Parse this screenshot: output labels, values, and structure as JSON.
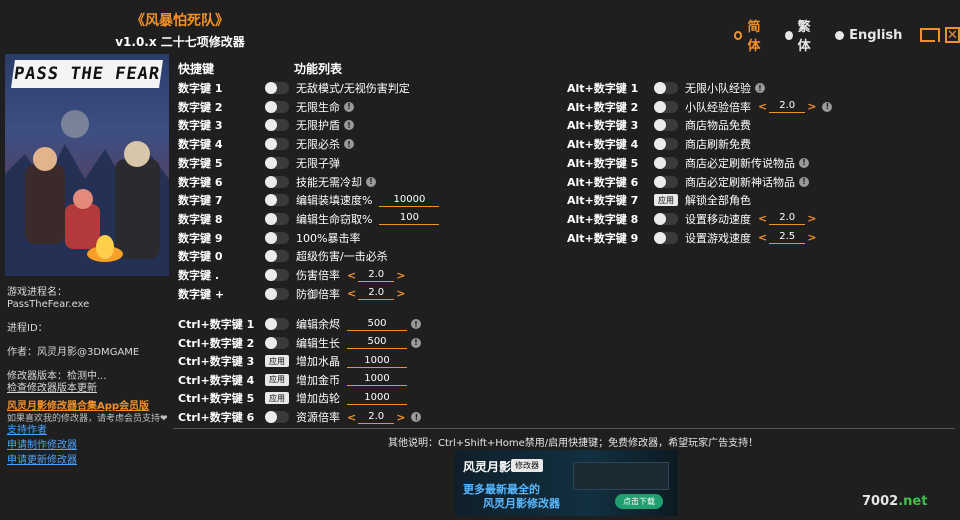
{
  "app": {
    "title": "《风暴怕死队》",
    "subtitle": "v1.0.x 二十七项修改器"
  },
  "languages": [
    {
      "label": "简体",
      "selected": true
    },
    {
      "label": "繁体",
      "selected": false
    },
    {
      "label": "English",
      "selected": false
    }
  ],
  "cover": {
    "logo_text": "PASS THE FEAR"
  },
  "side": {
    "process_label": "游戏进程名：",
    "process_value": "PassTheFear.exe",
    "pid_label": "进程ID：",
    "author": "作者：风灵月影@3DMGAME",
    "version": "修改器版本：检测中...",
    "check_update": "检查修改器版本更新",
    "promo": "风灵月影修改器合集App会员版",
    "support_msg": "如果喜欢我的修改器，请考虑会员支持❤",
    "links": [
      "支持作者",
      "申请制作修改器",
      "申请更新修改器"
    ]
  },
  "headers": {
    "hotkey": "快捷键",
    "functions": "功能列表"
  },
  "left_list": [
    {
      "key": "数字键 1",
      "ctl": "toggle",
      "name": "无敌模式/无视伤害判定"
    },
    {
      "key": "数字键 2",
      "ctl": "toggle",
      "name": "无限生命",
      "info": "!"
    },
    {
      "key": "数字键 3",
      "ctl": "toggle",
      "name": "无限护盾",
      "info": "!"
    },
    {
      "key": "数字键 4",
      "ctl": "toggle",
      "name": "无限必杀",
      "info": "!"
    },
    {
      "key": "数字键 5",
      "ctl": "toggle",
      "name": "无限子弹"
    },
    {
      "key": "数字键 6",
      "ctl": "toggle",
      "name": "技能无需冷却",
      "info": "!"
    },
    {
      "key": "数字键 7",
      "ctl": "toggle",
      "name": "编辑装填速度%",
      "field": "10000"
    },
    {
      "key": "数字键 8",
      "ctl": "toggle",
      "name": "编辑生命窃取%",
      "field": "100"
    },
    {
      "key": "数字键 9",
      "ctl": "toggle",
      "name": "100%暴击率"
    },
    {
      "key": "数字键 0",
      "ctl": "toggle",
      "name": "超级伤害/一击必杀"
    },
    {
      "key": "数字键 .",
      "ctl": "toggle",
      "name": "伤害倍率",
      "stepper": "2.0"
    },
    {
      "key": "数字键 +",
      "ctl": "toggle",
      "name": "防御倍率",
      "stepper": "2.0"
    }
  ],
  "ctrl_list": [
    {
      "key": "Ctrl+数字键 1",
      "ctl": "toggle",
      "name": "编辑余烬",
      "field": "500",
      "info": "!"
    },
    {
      "key": "Ctrl+数字键 2",
      "ctl": "toggle",
      "name": "编辑生长",
      "field": "500",
      "info": "!"
    },
    {
      "key": "Ctrl+数字键 3",
      "ctl": "apply",
      "name": "增加水晶",
      "field": "1000"
    },
    {
      "key": "Ctrl+数字键 4",
      "ctl": "apply",
      "name": "增加金币",
      "field": "1000"
    },
    {
      "key": "Ctrl+数字键 5",
      "ctl": "apply",
      "name": "增加齿轮",
      "field": "1000"
    },
    {
      "key": "Ctrl+数字键 6",
      "ctl": "toggle",
      "name": "资源倍率",
      "stepper": "2.0",
      "info": "!"
    }
  ],
  "alt_list": [
    {
      "key": "Alt+数字键 1",
      "ctl": "toggle",
      "name": "无限小队经验",
      "info": "!"
    },
    {
      "key": "Alt+数字键 2",
      "ctl": "toggle",
      "name": "小队经验倍率",
      "stepper": "2.0",
      "info": "!"
    },
    {
      "key": "Alt+数字键 3",
      "ctl": "toggle",
      "name": "商店物品免费"
    },
    {
      "key": "Alt+数字键 4",
      "ctl": "toggle",
      "name": "商店刷新免费"
    },
    {
      "key": "Alt+数字键 5",
      "ctl": "toggle",
      "name": "商店必定刷新传说物品",
      "info": "!"
    },
    {
      "key": "Alt+数字键 6",
      "ctl": "toggle",
      "name": "商店必定刷新神话物品",
      "info": "!"
    },
    {
      "key": "Alt+数字键 7",
      "ctl": "apply",
      "name": "解锁全部角色"
    },
    {
      "key": "Alt+数字键 8",
      "ctl": "toggle",
      "name": "设置移动速度",
      "stepper": "2.0"
    },
    {
      "key": "Alt+数字键 9",
      "ctl": "toggle",
      "name": "设置游戏速度",
      "stepper": "2.5"
    }
  ],
  "apply_label": "应用",
  "footer_note": "其他说明：Ctrl+Shift+Home禁用/启用快捷键；免费修改器，希望玩家广告支持！",
  "banner": {
    "brand": "风灵月影",
    "tag": "修改器",
    "line1": "更多最新最全的",
    "line2": "风灵月影修改器",
    "download": "点击下载"
  },
  "watermark": {
    "a": "7002",
    "b": ".net"
  },
  "colors": {
    "accent": "#f2902a",
    "link": "#4aa3ff",
    "background": "#1f1f1f"
  }
}
